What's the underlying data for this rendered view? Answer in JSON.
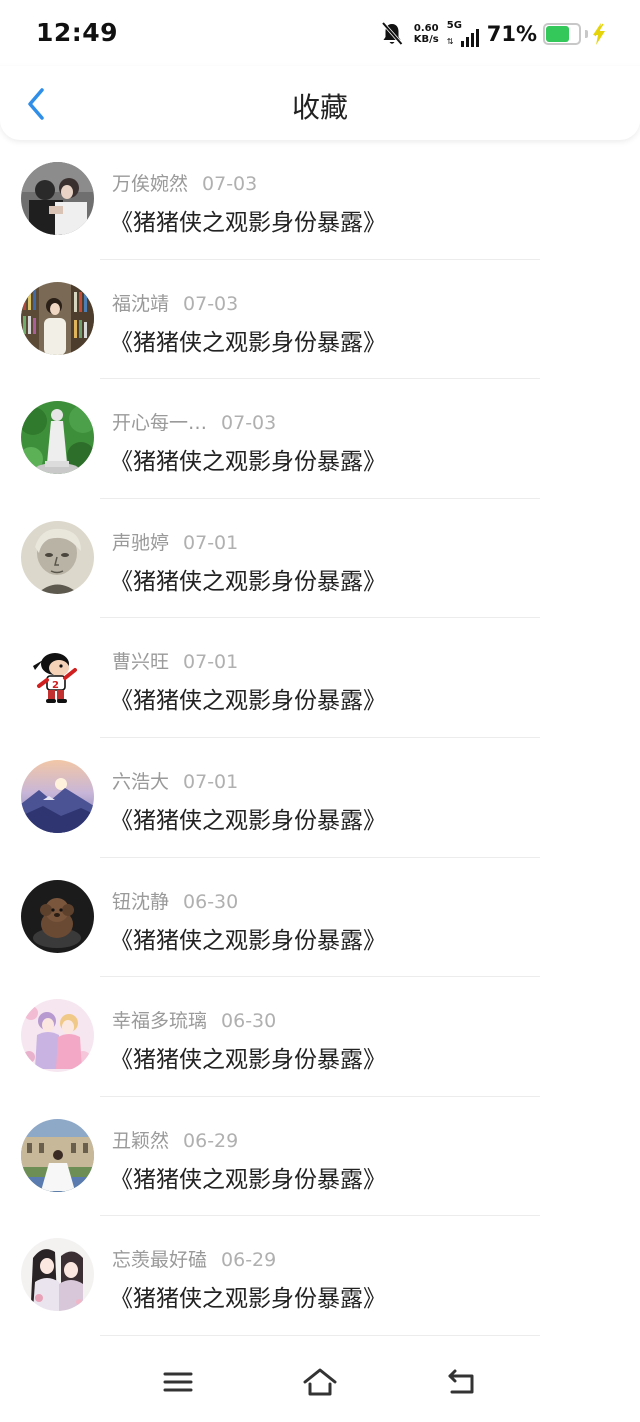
{
  "status_bar": {
    "time": "12:49",
    "net_speed_value": "0.60",
    "net_speed_unit": "KB/s",
    "network": "5G",
    "battery_pct": "71%",
    "battery_level": 0.71,
    "battery_color": "#34c759",
    "icons": [
      "bell-muted-icon",
      "signal-icon",
      "battery-icon",
      "charging-bolt-icon"
    ]
  },
  "header": {
    "back_icon": "chevron-left-icon",
    "title": "收藏",
    "accent_color": "#2f8fe8"
  },
  "favorites": [
    {
      "name": "万俟婉然",
      "date": "07-03",
      "title": "《猪猪侠之观影身份暴露》",
      "avatar": "couple-photo-avatar"
    },
    {
      "name": "福沈靖",
      "date": "07-03",
      "title": "《猪猪侠之观影身份暴露》",
      "avatar": "library-girl-avatar"
    },
    {
      "name": "开心每一…",
      "date": "07-03",
      "title": "《猪猪侠之观影身份暴露》",
      "avatar": "statue-garden-avatar"
    },
    {
      "name": "声驰婷",
      "date": "07-01",
      "title": "《猪猪侠之观影身份暴露》",
      "avatar": "sketch-portrait-avatar"
    },
    {
      "name": "曹兴旺",
      "date": "07-01",
      "title": "《猪猪侠之观影身份暴露》",
      "avatar": "cartoon-kid-avatar"
    },
    {
      "name": "六浩大",
      "date": "07-01",
      "title": "《猪猪侠之观影身份暴露》",
      "avatar": "sunset-mountain-avatar"
    },
    {
      "name": "钮沈静",
      "date": "06-30",
      "title": "《猪猪侠之观影身份暴露》",
      "avatar": "plush-dog-avatar"
    },
    {
      "name": "幸福多琉璃",
      "date": "06-30",
      "title": "《猪猪侠之观影身份暴露》",
      "avatar": "anime-girls-avatar"
    },
    {
      "name": "丑颖然",
      "date": "06-29",
      "title": "《猪猪侠之观影身份暴露》",
      "avatar": "palace-bride-avatar"
    },
    {
      "name": "忘羡最好磕",
      "date": "06-29",
      "title": "《猪猪侠之观影身份暴露》",
      "avatar": "anime-couple-avatar"
    }
  ],
  "system_nav": {
    "icons": [
      "menu-icon",
      "home-icon",
      "back-return-icon"
    ]
  }
}
